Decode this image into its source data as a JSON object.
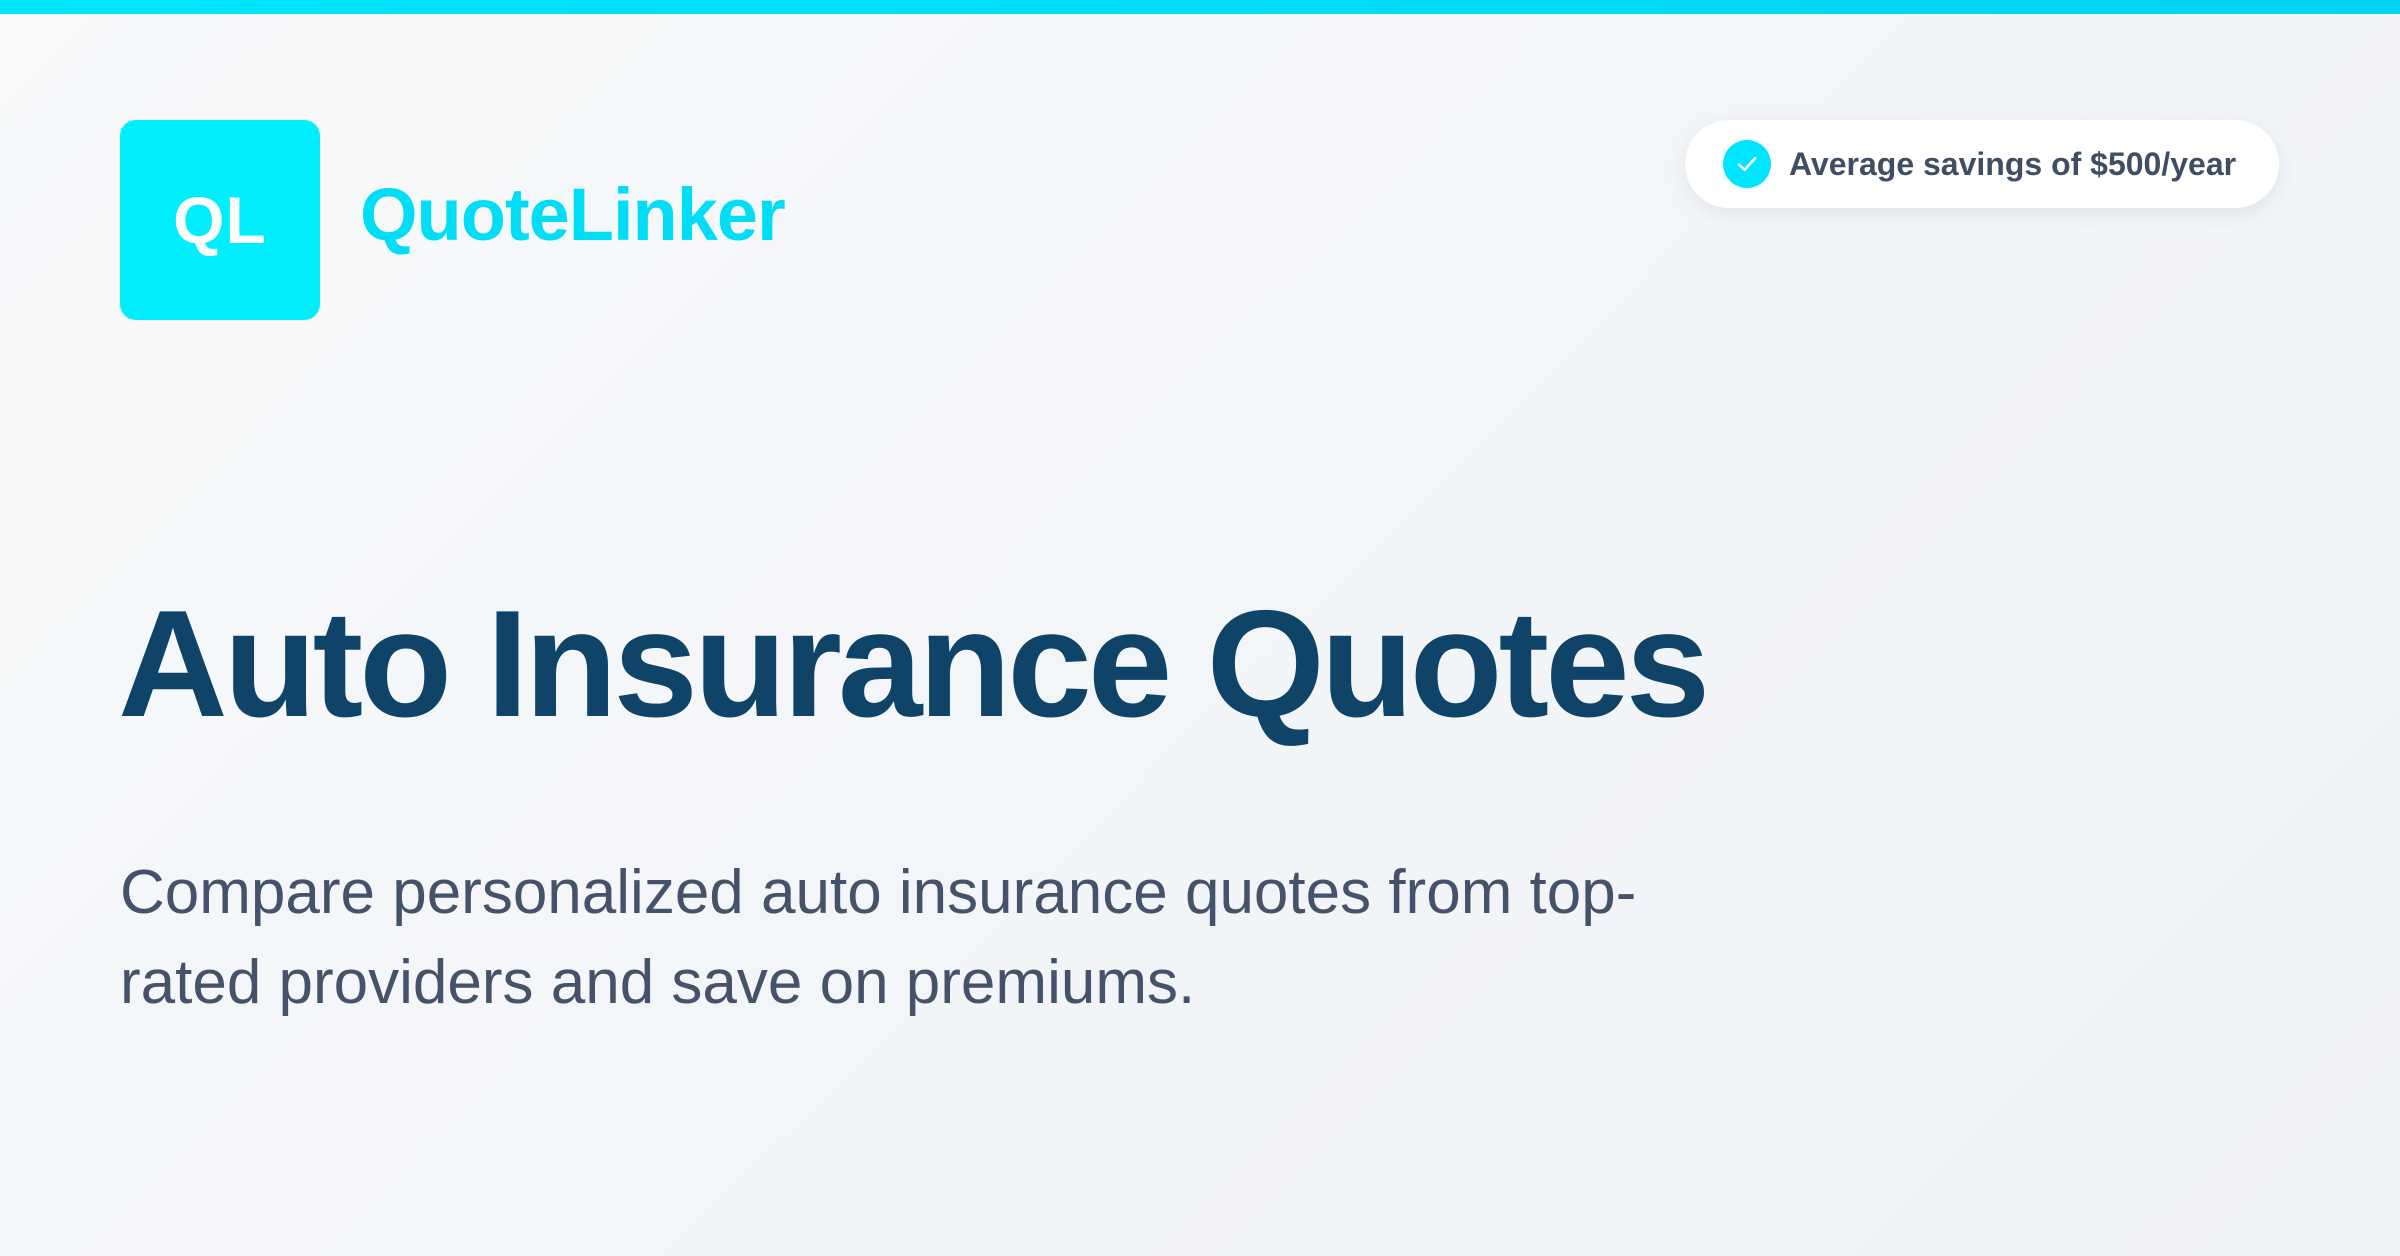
{
  "brand": {
    "logo_initials": "QL",
    "name": "QuoteLinker"
  },
  "badge": {
    "icon": "check-circle-icon",
    "text": "Average savings of $500/year"
  },
  "hero": {
    "headline": "Auto Insurance Quotes",
    "subtitle": "Compare personalized auto insurance quotes from top-rated providers and save on premiums."
  },
  "colors": {
    "accent": "#00e5ff",
    "headline": "#0f4468",
    "body_text": "#44536a",
    "background": "#f4f6f9"
  }
}
